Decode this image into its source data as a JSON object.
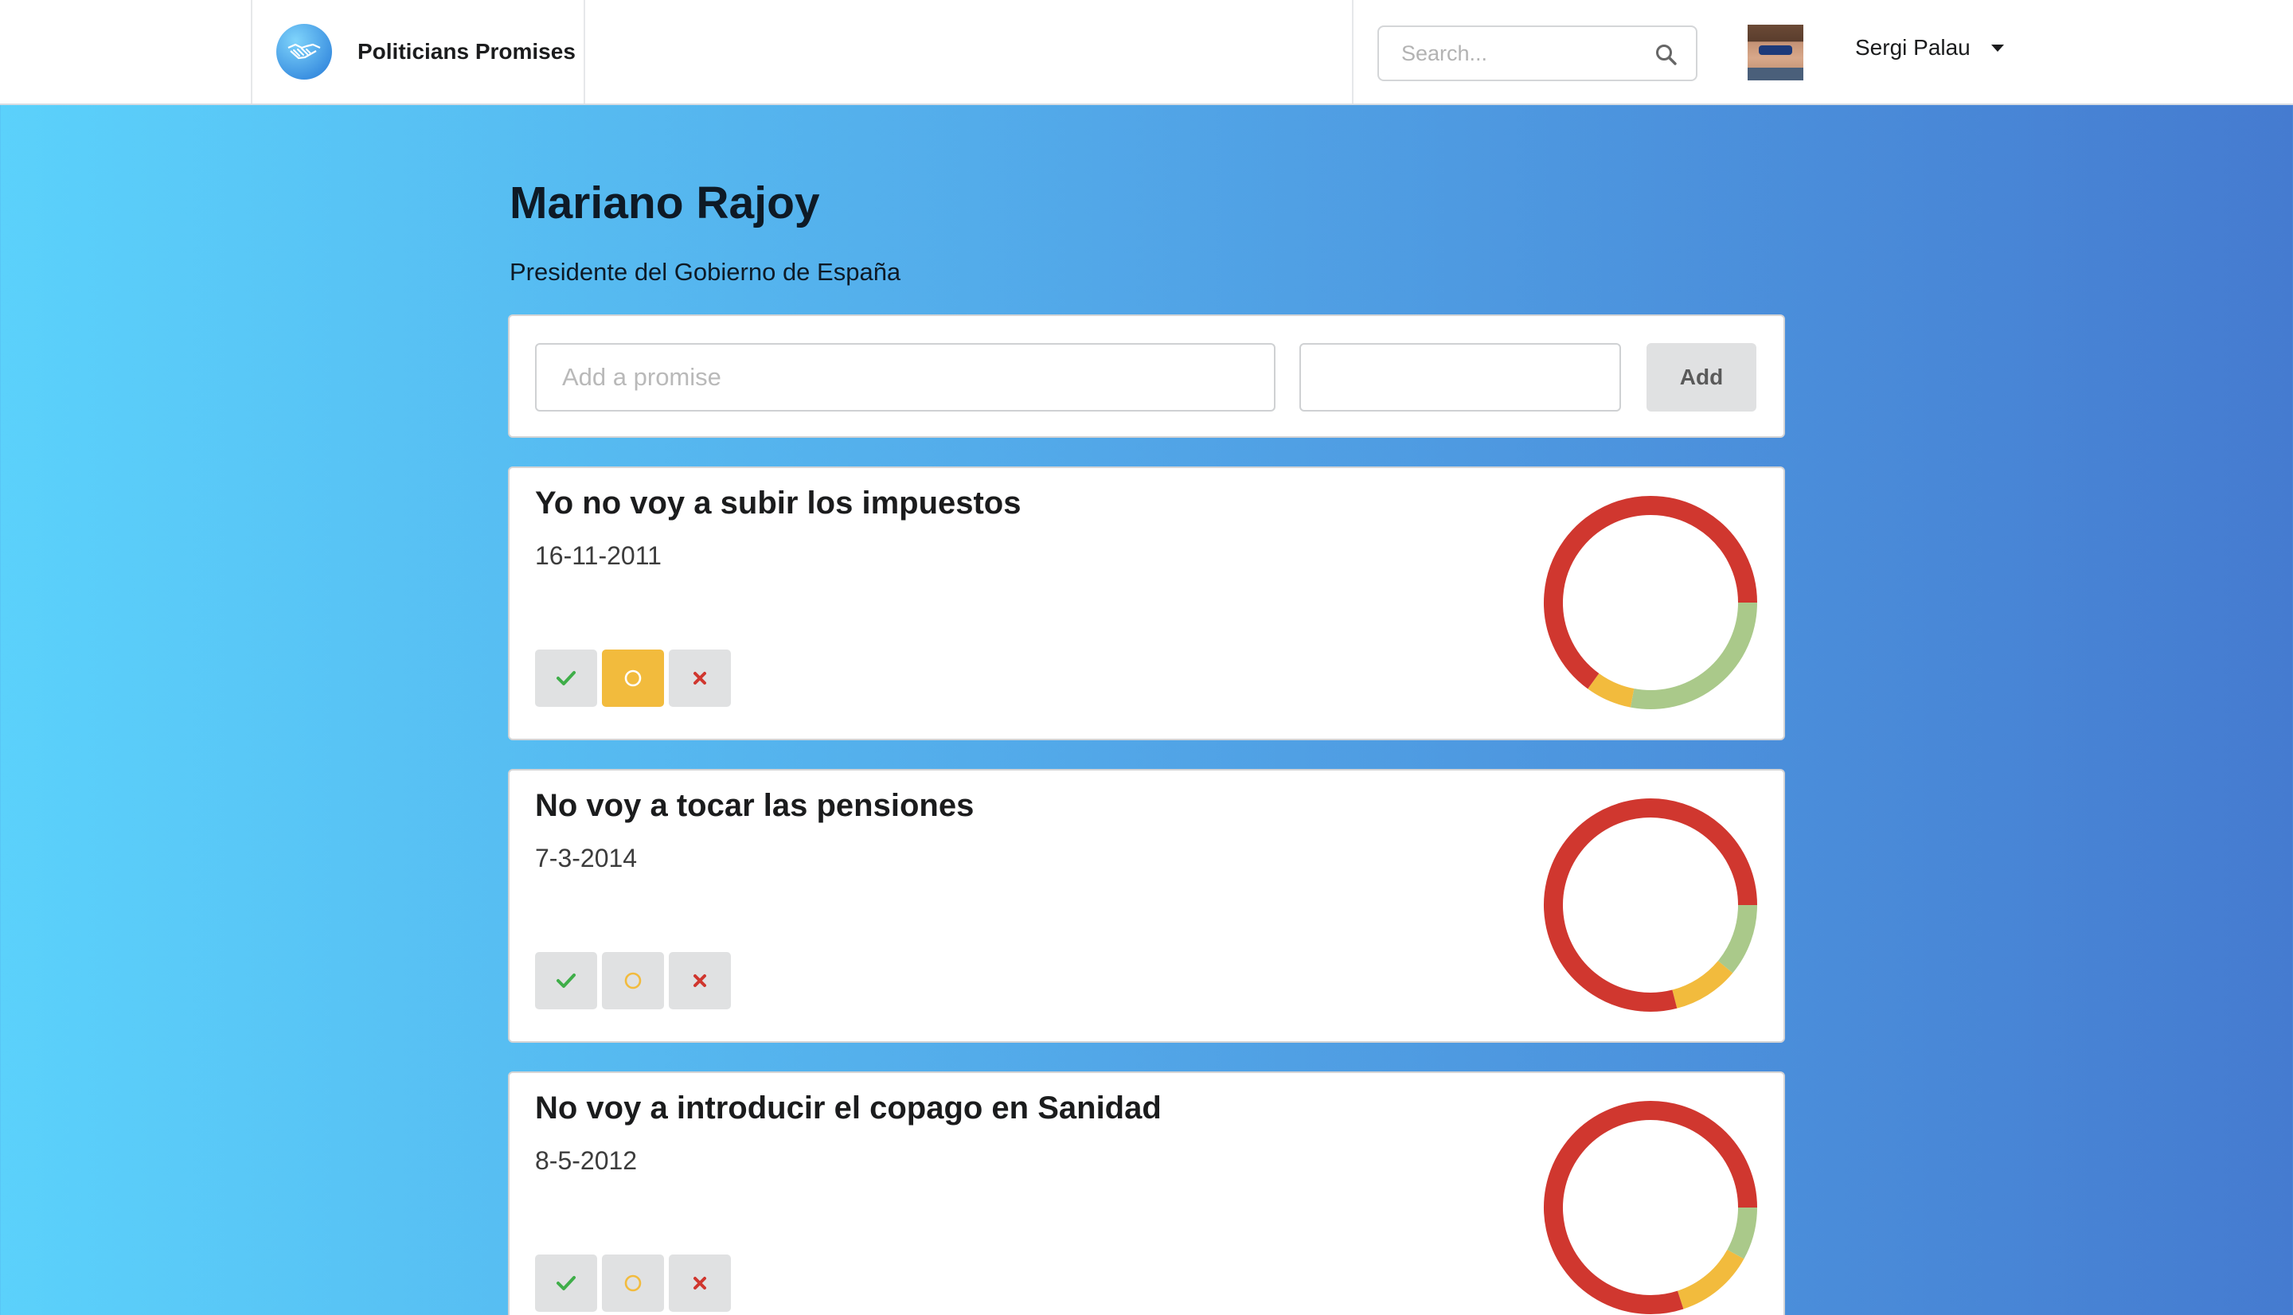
{
  "header": {
    "brand_name": "Politicians Promises",
    "search_placeholder": "Search...",
    "user_name": "Sergi Palau"
  },
  "politician": {
    "name": "Mariano Rajoy",
    "role": "Presidente del Gobierno de España"
  },
  "add_form": {
    "promise_placeholder": "Add a promise",
    "date_value": "",
    "button_label": "Add"
  },
  "colors": {
    "red": "#d0372f",
    "yellow": "#f2bb3d",
    "green": "#aac98a",
    "check": "#3fae49",
    "cross": "#d0372f"
  },
  "promises": [
    {
      "title": "Yo no voy a subir los impuestos",
      "date": "16-11-2011",
      "selected": "partial",
      "ratings": {
        "green": 0.28,
        "yellow": 0.07,
        "red": 0.65
      }
    },
    {
      "title": "No voy a tocar las pensiones",
      "date": "7-3-2014",
      "selected": "",
      "ratings": {
        "green": 0.11,
        "yellow": 0.1,
        "red": 0.79
      }
    },
    {
      "title": "No voy a introducir el copago en Sanidad",
      "date": "8-5-2012",
      "selected": "",
      "ratings": {
        "green": 0.08,
        "yellow": 0.12,
        "red": 0.8
      }
    }
  ]
}
